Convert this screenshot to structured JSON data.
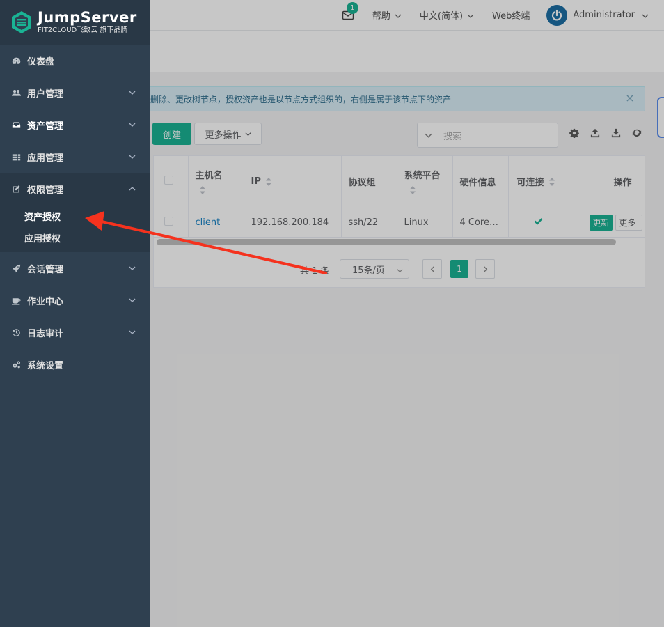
{
  "brand": {
    "title": "JumpServer",
    "subtitle": "FIT2CLOUD飞致云 旗下品牌"
  },
  "sidebar": {
    "items": [
      {
        "label": "仪表盘",
        "icon": "dashboard-icon"
      },
      {
        "label": "用户管理",
        "icon": "users-icon"
      },
      {
        "label": "资产管理",
        "icon": "inbox-icon"
      },
      {
        "label": "应用管理",
        "icon": "grid-icon"
      },
      {
        "label": "权限管理",
        "icon": "edit-icon"
      },
      {
        "label": "会话管理",
        "icon": "rocket-icon"
      },
      {
        "label": "作业中心",
        "icon": "coffee-icon"
      },
      {
        "label": "日志审计",
        "icon": "history-icon"
      },
      {
        "label": "系统设置",
        "icon": "gears-icon"
      }
    ],
    "perm_sub": [
      "资产授权",
      "应用授权"
    ]
  },
  "header": {
    "notification_count": "1",
    "help": "帮助",
    "language": "中文(简体)",
    "web_terminal": "Web终端",
    "user": "Administrator"
  },
  "alert": {
    "text": "删除、更改树节点，授权资产也是以节点方式组织的，右侧是属于该节点下的资产",
    "close": "×"
  },
  "toolbar": {
    "create": "创建",
    "more_actions": "更多操作",
    "search_placeholder": "搜索"
  },
  "table": {
    "columns": [
      "主机名",
      "IP",
      "协议组",
      "系统平台",
      "硬件信息",
      "可连接",
      "操作"
    ],
    "rows": [
      {
        "hostname": "client",
        "ip": "192.168.200.184",
        "protocols": "ssh/22",
        "platform": "Linux",
        "hardware": "4 Core…",
        "connectable": true,
        "update": "更新",
        "more": "更多"
      }
    ]
  },
  "pagination": {
    "total": "共 1 条",
    "page_size": "15条/页",
    "current": "1"
  },
  "colors": {
    "sidebar_bg": "#2f4050",
    "accent": "#1ab394",
    "link": "#1c84c6",
    "annotation_arrow": "#f5321e"
  }
}
